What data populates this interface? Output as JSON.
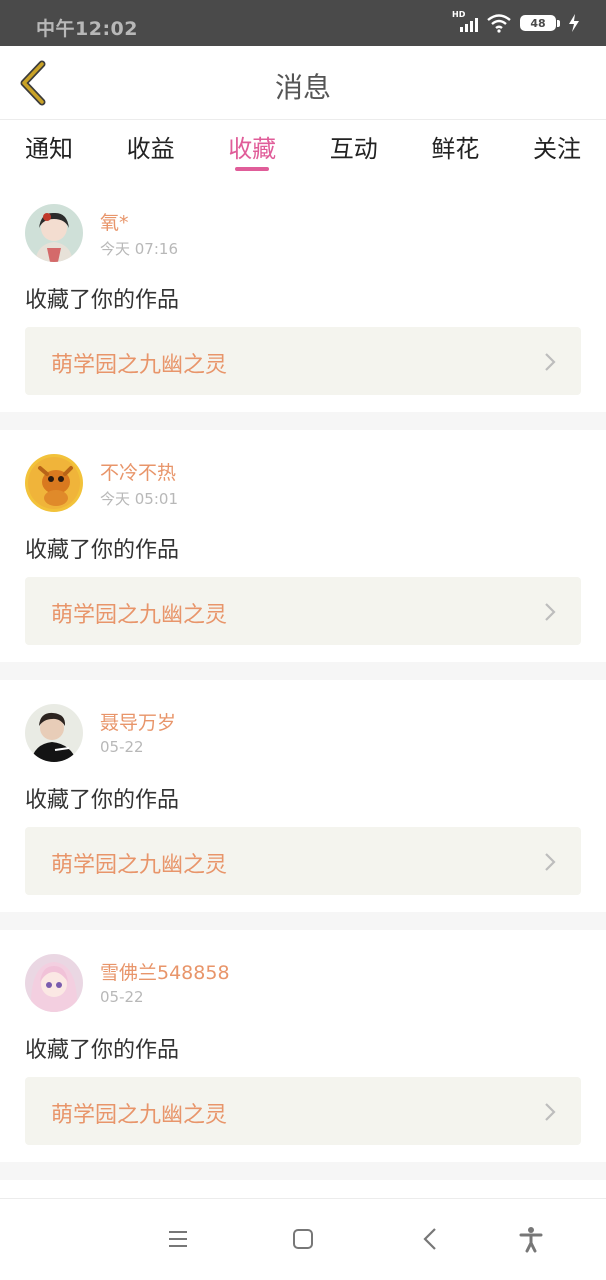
{
  "status_bar": {
    "time": "中午12:02",
    "network": "HD",
    "battery": "48"
  },
  "header": {
    "title": "消息",
    "back_icon": "chevron-left-icon"
  },
  "tabs": [
    {
      "label": "通知",
      "active": false
    },
    {
      "label": "收益",
      "active": false
    },
    {
      "label": "收藏",
      "active": true
    },
    {
      "label": "互动",
      "active": false
    },
    {
      "label": "鲜花",
      "active": false
    },
    {
      "label": "关注",
      "active": false
    }
  ],
  "messages": [
    {
      "user": "氧*",
      "time": "今天 07:16",
      "action": "收藏了你的作品",
      "work_title": "萌学园之九幽之灵"
    },
    {
      "user": "不冷不热",
      "time": "今天 05:01",
      "action": "收藏了你的作品",
      "work_title": "萌学园之九幽之灵"
    },
    {
      "user": "聂导万岁",
      "time": "05-22",
      "action": "收藏了你的作品",
      "work_title": "萌学园之九幽之灵"
    },
    {
      "user": "雪佛兰548858",
      "time": "05-22",
      "action": "收藏了你的作品",
      "work_title": "萌学园之九幽之灵"
    }
  ],
  "nav_bar": [
    "menu-icon",
    "home-square-icon",
    "back-arrow-icon",
    "accessibility-icon"
  ],
  "colors": {
    "accent_pink": "#e05d99",
    "name_orange": "#e8956a",
    "back_gold": "#c9a227",
    "status_bar_bg": "#4a4a4a",
    "card_bg": "#f4f4ee"
  }
}
